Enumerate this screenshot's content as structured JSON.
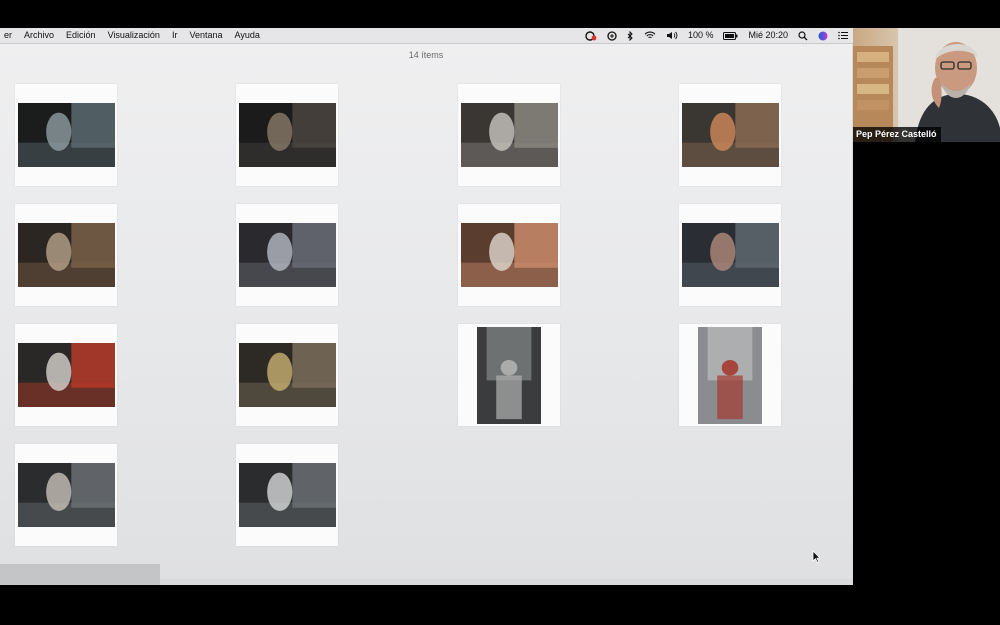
{
  "menubar": {
    "items": [
      "er",
      "Archivo",
      "Edición",
      "Visualización",
      "Ir",
      "Ventana",
      "Ayuda"
    ],
    "battery": "100 %",
    "clock": "Mié 20:20"
  },
  "window": {
    "item_count": "14 ítems"
  },
  "video": {
    "participant_name": "Pep Pérez Castelló"
  },
  "photos": [
    {
      "label": "photo-woman-at-window"
    },
    {
      "label": "photo-kitchen-scale"
    },
    {
      "label": "photo-woman-reaching-shelf"
    },
    {
      "label": "photo-eggs-in-bowl"
    },
    {
      "label": "photo-woman-at-door"
    },
    {
      "label": "photo-man-on-sofa"
    },
    {
      "label": "photo-framed-portrait-held"
    },
    {
      "label": "photo-hands-with-papers"
    },
    {
      "label": "photo-woman-holding-photo"
    },
    {
      "label": "photo-living-room-lamp"
    },
    {
      "label": "photo-portrait-on-shelf"
    },
    {
      "label": "photo-woman-in-red-coat"
    },
    {
      "label": "photo-vintage-radio"
    },
    {
      "label": "photo-woman-in-hallway"
    }
  ]
}
